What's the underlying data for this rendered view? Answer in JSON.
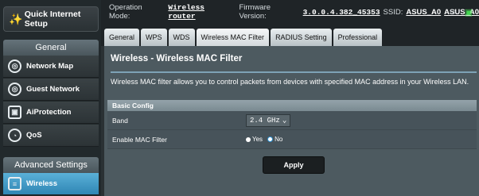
{
  "sidebar": {
    "qis_label": "Quick Internet Setup",
    "general_title": "General",
    "general_items": [
      {
        "label": "Network Map"
      },
      {
        "label": "Guest Network"
      },
      {
        "label": "AiProtection"
      },
      {
        "label": "QoS"
      }
    ],
    "advanced_title": "Advanced Settings",
    "advanced_items": [
      {
        "label": "Wireless"
      }
    ]
  },
  "topbar": {
    "mode_label": "Operation Mode:",
    "mode_value": "Wireless router",
    "fw_label": "Firmware Version:",
    "fw_value": "3.0.0.4.382_45353",
    "ssid_label": "SSID:",
    "ssid_1": "ASUS_A0",
    "ssid_2": "ASUS_A0"
  },
  "tabs": [
    {
      "label": "General"
    },
    {
      "label": "WPS"
    },
    {
      "label": "WDS"
    },
    {
      "label": "Wireless MAC Filter"
    },
    {
      "label": "RADIUS Setting"
    },
    {
      "label": "Professional"
    }
  ],
  "page": {
    "title": "Wireless - Wireless MAC Filter",
    "description": "Wireless MAC filter allows you to control packets from devices with specified MAC address in your Wireless LAN.",
    "table_header": "Basic Config",
    "band_label": "Band",
    "band_value": "2.4 GHz",
    "mac_filter_label": "Enable MAC Filter",
    "radio_yes": "Yes",
    "radio_no": "No",
    "apply_label": "Apply"
  }
}
